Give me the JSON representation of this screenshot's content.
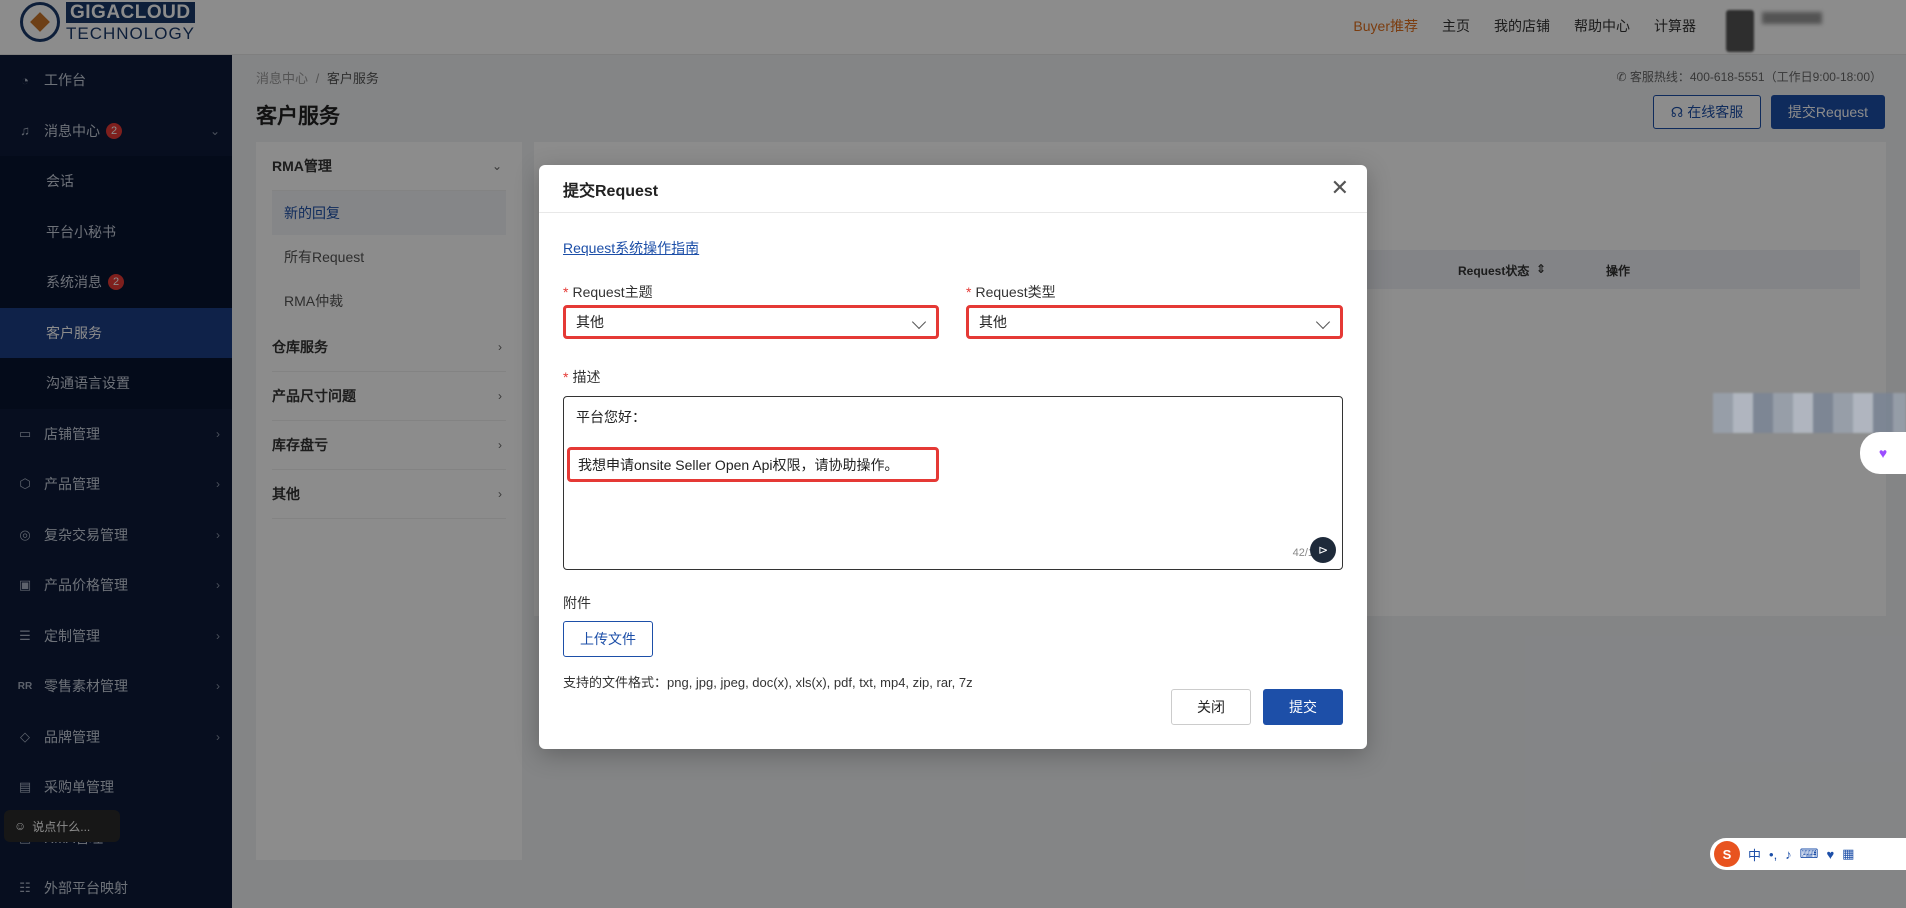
{
  "header": {
    "logo_line1": "GIGACLOUD",
    "logo_line2": "TECHNOLOGY",
    "nav": [
      "Buyer推荐",
      "主页",
      "我的店铺",
      "帮助中心",
      "计算器"
    ]
  },
  "sidebar": {
    "items": [
      {
        "label": "工作台",
        "icon": "dashboard-icon"
      },
      {
        "label": "消息中心",
        "icon": "bell-icon",
        "badge": "2"
      },
      {
        "label": "会话"
      },
      {
        "label": "平台小秘书"
      },
      {
        "label": "系统消息",
        "badge": "2"
      },
      {
        "label": "客户服务"
      },
      {
        "label": "沟通语言设置"
      },
      {
        "label": "店铺管理",
        "icon": "store-icon"
      },
      {
        "label": "产品管理",
        "icon": "box-icon"
      },
      {
        "label": "复杂交易管理",
        "icon": "trade-icon"
      },
      {
        "label": "产品价格管理",
        "icon": "price-icon"
      },
      {
        "label": "定制管理",
        "icon": "list-icon"
      },
      {
        "label": "零售素材管理",
        "icon": "rr-icon"
      },
      {
        "label": "品牌管理",
        "icon": "diamond-icon"
      },
      {
        "label": "采购单管理",
        "icon": "doc-icon"
      },
      {
        "label": "RMA管理",
        "icon": "rma-icon"
      },
      {
        "label": "外部平台映射",
        "icon": "map-icon"
      }
    ],
    "chat_placeholder": "说点什么..."
  },
  "main": {
    "breadcrumb": [
      "消息中心",
      "客户服务"
    ],
    "breadcrumb_sep": "/",
    "hotline": "客服热线：400-618-5551（工作日9:00-18:00）",
    "title": "客户服务",
    "online_service": "在线客服",
    "submit_request": "提交Request"
  },
  "left_panel": {
    "group1": "RMA管理",
    "subs": [
      "新的回复",
      "所有Request",
      "RMA仲裁"
    ],
    "groups": [
      "仓库服务",
      "产品尺寸问题",
      "库存盘亏",
      "其他"
    ]
  },
  "table": {
    "columns": [
      "Request状态",
      "操作"
    ]
  },
  "modal": {
    "title": "提交Request",
    "guide_link": "Request系统操作指南",
    "topic_label": "Request主题",
    "topic_value": "其他",
    "type_label": "Request类型",
    "type_value": "其他",
    "desc_label": "描述",
    "desc_line1": "平台您好：",
    "desc_line2": "我想申请onsite Seller Open Api权限，请协助操作。",
    "char_count": "42/1",
    "attachment_label": "附件",
    "upload_button": "上传文件",
    "formats_hint": "支持的文件格式：png, jpg, jpeg, doc(x), xls(x), pdf, txt, mp4, zip, rar, 7z",
    "close_button": "关闭",
    "submit_button": "提交"
  },
  "ime": {
    "brand": "S",
    "mode": "中"
  },
  "colors": {
    "primary": "#1d4fa8",
    "sidebar": "#0d1b3a",
    "highlight": "#e53935",
    "hot": "#e0701e"
  }
}
